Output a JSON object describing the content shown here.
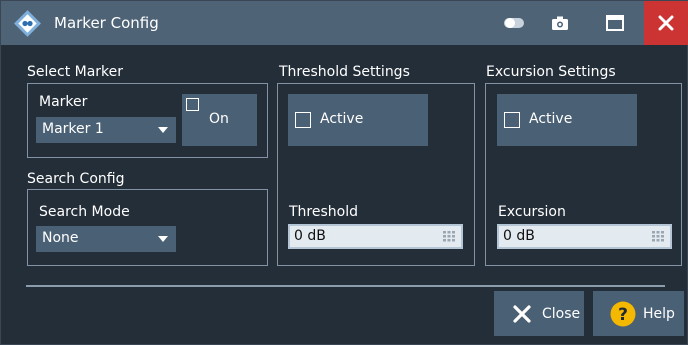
{
  "window": {
    "title": "Marker Config",
    "icons": [
      "logo-icon",
      "toggle-icon",
      "camera-icon",
      "maximize-icon",
      "close-icon"
    ]
  },
  "select_marker": {
    "group_label": "Select Marker",
    "marker_label": "Marker",
    "marker_value": "Marker 1",
    "on_label": "On",
    "on_checked": false
  },
  "search_config": {
    "group_label": "Search Config",
    "search_mode_label": "Search Mode",
    "search_mode_value": "None"
  },
  "threshold": {
    "group_label": "Threshold Settings",
    "active_label": "Active",
    "active_checked": false,
    "field_label": "Threshold",
    "value": "0 dB"
  },
  "excursion": {
    "group_label": "Excursion Settings",
    "active_label": "Active",
    "active_checked": false,
    "field_label": "Excursion",
    "value": "0 dB"
  },
  "footer": {
    "close_label": "Close",
    "help_label": "Help"
  },
  "colors": {
    "titlebar": "#4f6377",
    "background": "#242e39",
    "button": "#4a6075",
    "close_red": "#cc3333",
    "help_yellow": "#f5b800",
    "input_bg": "#e3eaf0"
  }
}
